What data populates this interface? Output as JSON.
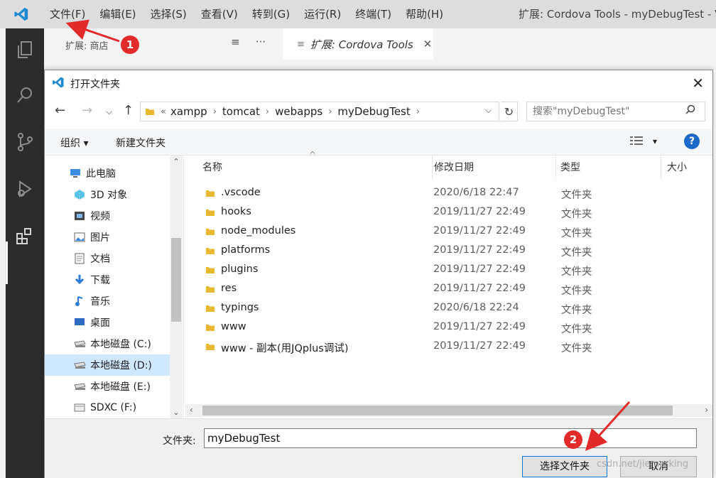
{
  "app": {
    "window_title": "扩展: Cordova Tools - myDebugTest - Visu",
    "menu": [
      "文件(F)",
      "编辑(E)",
      "选择(S)",
      "查看(V)",
      "转到(G)",
      "运行(R)",
      "终端(T)",
      "帮助(H)"
    ]
  },
  "sidebar": {
    "title": "扩展: 商店",
    "actions": [
      "≡",
      "···"
    ]
  },
  "editor": {
    "tab_label": "扩展: Cordova Tools",
    "tab_close": "✕"
  },
  "badges": {
    "one": "1",
    "two": "2"
  },
  "dialog": {
    "title": "打开文件夹",
    "close": "✕",
    "breadcrumb_prefix": "«",
    "breadcrumb": [
      "xampp",
      "tomcat",
      "webapps",
      "myDebugTest"
    ],
    "search_placeholder": "搜索\"myDebugTest\"",
    "toolbar": {
      "organize": "组织 ▾",
      "new_folder": "新建文件夹",
      "view_dd": "▾",
      "help": "?"
    },
    "nav_items": [
      {
        "label": "此电脑",
        "icon": "computer-icon"
      },
      {
        "label": "3D 对象",
        "icon": "3d-objects-icon"
      },
      {
        "label": "视频",
        "icon": "video-icon"
      },
      {
        "label": "图片",
        "icon": "pictures-icon"
      },
      {
        "label": "文档",
        "icon": "documents-icon"
      },
      {
        "label": "下载",
        "icon": "download-icon"
      },
      {
        "label": "音乐",
        "icon": "music-icon"
      },
      {
        "label": "桌面",
        "icon": "desktop-icon"
      },
      {
        "label": "本地磁盘 (C:)",
        "icon": "drive-icon"
      },
      {
        "label": "本地磁盘 (D:)",
        "icon": "drive-icon",
        "selected": true
      },
      {
        "label": "本地磁盘 (E:)",
        "icon": "drive-icon"
      },
      {
        "label": "SDXC (F:)",
        "icon": "sd-card-icon"
      }
    ],
    "columns": [
      "名称",
      "修改日期",
      "类型",
      "大小"
    ],
    "files": [
      {
        "name": ".vscode",
        "date": "2020/6/18 22:47",
        "type": "文件夹"
      },
      {
        "name": "hooks",
        "date": "2019/11/27 22:49",
        "type": "文件夹"
      },
      {
        "name": "node_modules",
        "date": "2019/11/27 22:49",
        "type": "文件夹"
      },
      {
        "name": "platforms",
        "date": "2019/11/27 22:49",
        "type": "文件夹"
      },
      {
        "name": "plugins",
        "date": "2019/11/27 22:49",
        "type": "文件夹"
      },
      {
        "name": "res",
        "date": "2019/11/27 22:49",
        "type": "文件夹"
      },
      {
        "name": "typings",
        "date": "2020/6/18 22:24",
        "type": "文件夹"
      },
      {
        "name": "www",
        "date": "2019/11/27 22:49",
        "type": "文件夹"
      },
      {
        "name": "www - 副本(用JQplus调试)",
        "date": "2019/11/27 22:49",
        "type": "文件夹"
      }
    ],
    "folder_label": "文件夹:",
    "folder_value": "myDebugTest",
    "select_button": "选择文件夹",
    "cancel_button": "取消"
  },
  "watermark": "csdn.net/jiemerking",
  "colors": {
    "accent": "#0078d7",
    "badge": "#e32a2a",
    "activity_bar": "#2c2c2c",
    "selected": "#cde8ff"
  }
}
